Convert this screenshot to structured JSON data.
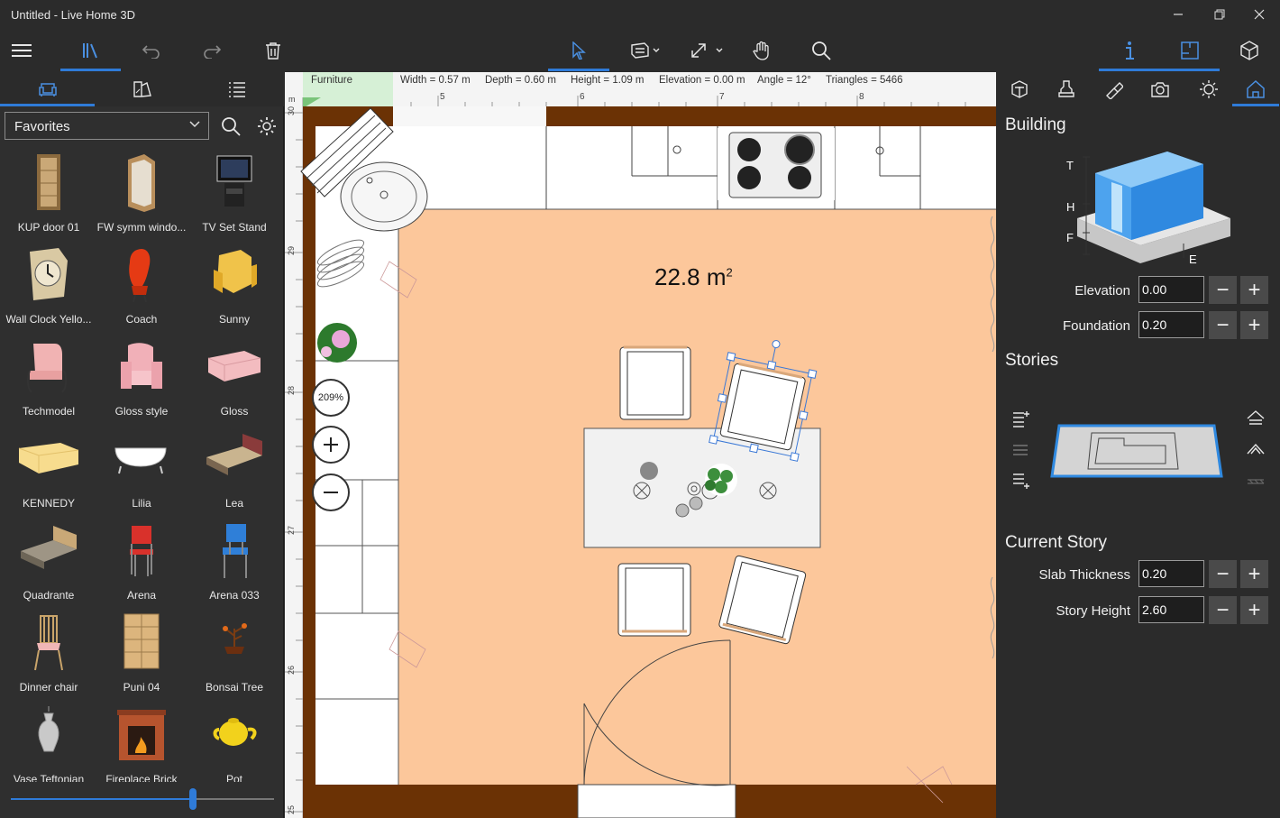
{
  "window": {
    "title": "Untitled - Live Home 3D"
  },
  "library": {
    "category": "Favorites",
    "items": [
      {
        "label": "KUP door 01"
      },
      {
        "label": "FW symm windo..."
      },
      {
        "label": "TV Set Stand"
      },
      {
        "label": "Wall Clock Yello..."
      },
      {
        "label": "Coach"
      },
      {
        "label": "Sunny"
      },
      {
        "label": "Techmodel"
      },
      {
        "label": "Gloss style"
      },
      {
        "label": "Gloss"
      },
      {
        "label": "KENNEDY"
      },
      {
        "label": "Lilia"
      },
      {
        "label": "Lea"
      },
      {
        "label": "Quadrante"
      },
      {
        "label": "Arena"
      },
      {
        "label": "Arena 033"
      },
      {
        "label": "Dinner chair"
      },
      {
        "label": "Puni 04"
      },
      {
        "label": "Bonsai Tree"
      },
      {
        "label": "Vase Teftonian"
      },
      {
        "label": "Fireplace Brick"
      },
      {
        "label": "Pot"
      }
    ],
    "zoom_slider": 0.69
  },
  "plan": {
    "info": {
      "furniture": "Furniture",
      "width": "Width = 0.57 m",
      "depth": "Depth = 0.60 m",
      "height": "Height = 1.09 m",
      "elevation": "Elevation = 0.00 m",
      "angle": "Angle = 12°",
      "triangles": "Triangles = 5466"
    },
    "ruler_top": [
      "m",
      "5",
      "6",
      "7",
      "8"
    ],
    "ruler_left": [
      "30",
      "29",
      "28",
      "27",
      "26",
      "25"
    ],
    "area_label": "22.8 m",
    "area_sup": "2",
    "zoom_level": "209%",
    "colors": {
      "floor": "#fcc79b",
      "wall": "#6b3205",
      "ruler": "#f4f4f4"
    }
  },
  "inspector": {
    "building_title": "Building",
    "diagram_letters": {
      "t": "T",
      "h": "H",
      "f": "F",
      "e": "E"
    },
    "elevation": {
      "label": "Elevation",
      "value": "0.00"
    },
    "foundation": {
      "label": "Foundation",
      "value": "0.20"
    },
    "stories_title": "Stories",
    "current_story_title": "Current Story",
    "slab_thickness": {
      "label": "Slab Thickness",
      "value": "0.20"
    },
    "story_height": {
      "label": "Story Height",
      "value": "2.60"
    },
    "minus": "−",
    "plus": "+"
  }
}
